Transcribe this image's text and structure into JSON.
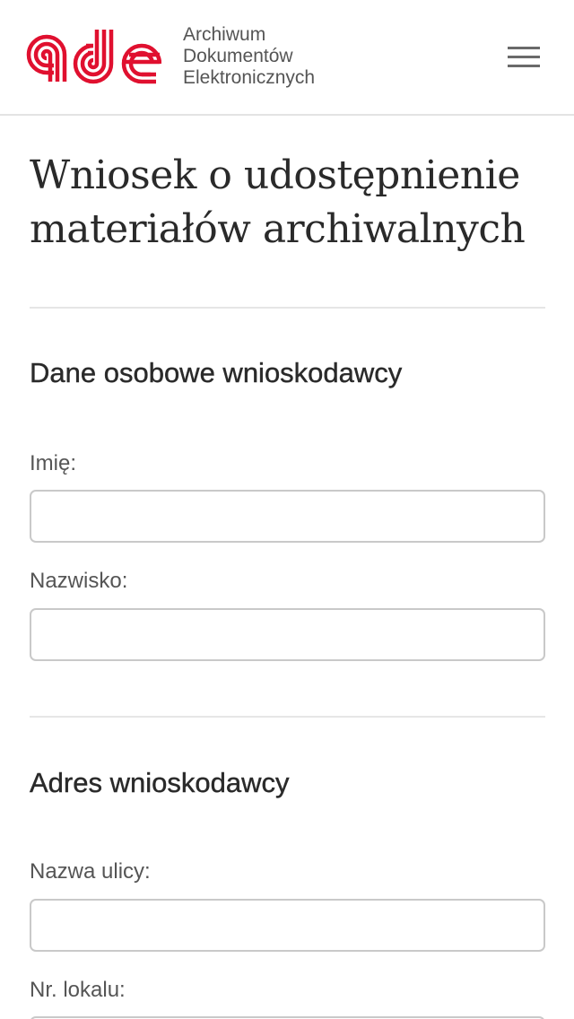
{
  "header": {
    "logo_alt": "ade",
    "brand_lines": [
      "Archiwum",
      "Dokumentów",
      "Elektronicznych"
    ],
    "menu_icon": "hamburger-menu-icon",
    "accent_color": "#e0102f"
  },
  "main": {
    "title": "Wniosek o udostępnienie materiałów archiwalnych",
    "sections": [
      {
        "heading": "Dane osobowe wnioskodawcy",
        "fields": [
          {
            "label": "Imię:",
            "value": ""
          },
          {
            "label": "Nazwisko:",
            "value": ""
          }
        ]
      },
      {
        "heading": "Adres wnioskodawcy",
        "fields": [
          {
            "label": "Nazwa ulicy:",
            "value": ""
          },
          {
            "label": "Nr. lokalu:",
            "value": ""
          }
        ]
      }
    ]
  }
}
